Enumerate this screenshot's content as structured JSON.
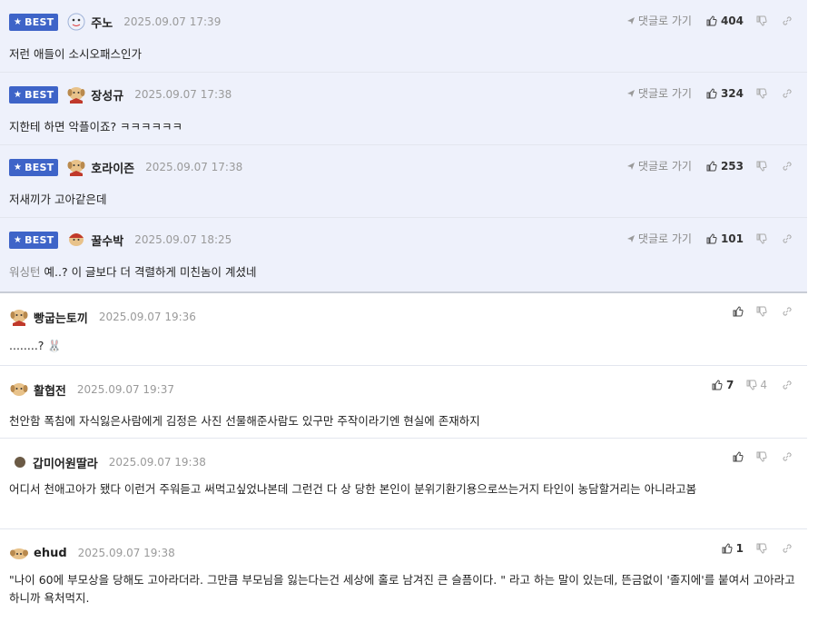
{
  "best_label": "BEST",
  "goto_label": "댓글로 가기",
  "comments": [
    {
      "best": true,
      "nick": "주노",
      "date": "2025.09.07 17:39",
      "text": "저런 애들이 소시오패스인가",
      "up": "404",
      "down": ""
    },
    {
      "best": true,
      "nick": "장성규",
      "date": "2025.09.07 17:38",
      "text": "지한테 하면 악플이죠? ㅋㅋㅋㅋㅋㅋ",
      "up": "324",
      "down": ""
    },
    {
      "best": true,
      "nick": "호라이즌",
      "date": "2025.09.07 17:38",
      "text": "저새끼가 고아같은데",
      "up": "253",
      "down": ""
    },
    {
      "best": true,
      "nick": "꿀수박",
      "date": "2025.09.07 18:25",
      "ref": "워싱턴",
      "text": "예..? 이 글보다 더 격렬하게 미친놈이 계셨네",
      "up": "101",
      "down": ""
    },
    {
      "best": false,
      "nick": "빵굽는토끼",
      "date": "2025.09.07 19:36",
      "text": "........? 🐰",
      "up": "",
      "down": ""
    },
    {
      "best": false,
      "nick": "활협전",
      "date": "2025.09.07 19:37",
      "text": "천안함 폭침에 자식잃은사람에게 김정은 사진 선물해준사람도 있구만 주작이라기엔 현실에 존재하지",
      "up": "7",
      "down": "4"
    },
    {
      "best": false,
      "nick": "갑미어원딸라",
      "date": "2025.09.07 19:38",
      "text": "어디서 천애고아가 됐다 이런거 주워듣고 써먹고싶었나본데 그런건 다 상 당한 본인이 분위기환기용으로쓰는거지 타인이 농담할거리는 아니라고봄",
      "up": "",
      "down": ""
    },
    {
      "best": false,
      "nick": "ehud",
      "date": "2025.09.07 19:38",
      "text": "\"나이 60에 부모상을 당해도 고아라더라. 그만큼 부모님을 잃는다는건 세상에 홀로 남겨진 큰 슬픔이다. \" 라고 하는 말이 있는데, 뜬금없이 '졸지에'를 붙여서 고아라고 하니까 욕처먹지.",
      "up": "1",
      "down": ""
    }
  ]
}
